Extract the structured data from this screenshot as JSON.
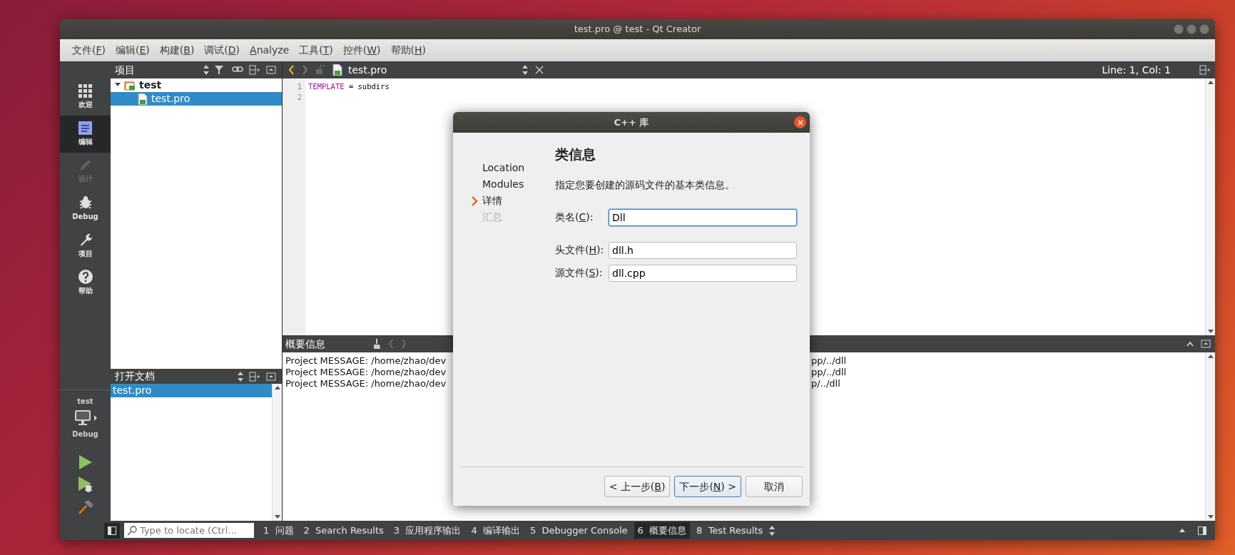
{
  "window": {
    "title": "test.pro @ test - Qt Creator"
  },
  "menu": [
    {
      "before": "文件(",
      "key": "F",
      "after": ")"
    },
    {
      "before": "编辑(",
      "key": "E",
      "after": ")"
    },
    {
      "before": "构建(",
      "key": "B",
      "after": ")"
    },
    {
      "before": "调试(",
      "key": "D",
      "after": ")"
    },
    {
      "key": "A",
      "after": "nalyze"
    },
    {
      "before": "工具(",
      "key": "T",
      "after": ")"
    },
    {
      "before": "控件(",
      "key": "W",
      "after": ")"
    },
    {
      "before": "帮助(",
      "key": "H",
      "after": ")"
    }
  ],
  "modes": [
    {
      "label": "欢迎",
      "kind": "welcome",
      "selected": false,
      "disabled": false
    },
    {
      "label": "编辑",
      "kind": "edit",
      "selected": true,
      "disabled": false
    },
    {
      "label": "设计",
      "kind": "design",
      "selected": false,
      "disabled": true
    },
    {
      "label": "Debug",
      "kind": "debug",
      "selected": false,
      "disabled": false
    },
    {
      "label": "项目",
      "kind": "projects",
      "selected": false,
      "disabled": false
    },
    {
      "label": "帮助",
      "kind": "help",
      "selected": false,
      "disabled": false
    }
  ],
  "kit": {
    "project": "test",
    "config": "Debug"
  },
  "project_pane": {
    "title": "项目",
    "tree": [
      {
        "label": "test",
        "expanded": true,
        "selected": false,
        "children": [
          {
            "label": "test.pro",
            "selected": true
          }
        ]
      }
    ]
  },
  "open_documents": {
    "title": "打开文档",
    "items": [
      {
        "label": "test.pro",
        "selected": true
      }
    ]
  },
  "editor": {
    "tab": "test.pro",
    "cursor": "Line: 1, Col: 1",
    "lines": [
      {
        "number": "1",
        "code": [
          {
            "text": "TEMPLATE",
            "kind": "keyword"
          },
          {
            "text": " = subdirs",
            "kind": "plain"
          }
        ]
      },
      {
        "number": "2"
      }
    ]
  },
  "output_panel": {
    "title": "概要信息",
    "lines": [
      {
        "left": "Project MESSAGE: /home/zhao/dev",
        "right": "pp/../dll"
      },
      {
        "left": "Project MESSAGE: /home/zhao/dev",
        "right": "pp/../dll"
      },
      {
        "left": "Project MESSAGE: /home/zhao/dev",
        "right": "p/../dll"
      }
    ]
  },
  "dialog": {
    "title": "C++ 库",
    "steps": [
      {
        "label": "Location",
        "selected": false,
        "disabled": false
      },
      {
        "label": "Modules",
        "selected": false,
        "disabled": false
      },
      {
        "label": "详情",
        "selected": true,
        "disabled": false
      },
      {
        "label": "汇总",
        "selected": false,
        "disabled": true
      }
    ],
    "heading": "类信息",
    "description": "指定您要创建的源码文件的基本类信息。",
    "fields": [
      {
        "label": {
          "before": "类名(",
          "key": "C",
          "after": "):"
        },
        "value": "Dll",
        "focused": true
      },
      {
        "label": {
          "before": "头文件(",
          "key": "H",
          "after": "):"
        },
        "value": "dll.h",
        "focused": false
      },
      {
        "label": {
          "before": "源文件(",
          "key": "S",
          "after": "):"
        },
        "value": "dll.cpp",
        "focused": false
      }
    ],
    "buttons": [
      {
        "label": {
          "before": "< 上一步(",
          "key": "B",
          "after": ")"
        },
        "default": false
      },
      {
        "label": {
          "before": "下一步(",
          "key": "N",
          "after": ") >"
        },
        "default": true
      },
      {
        "label": {
          "before": "取消"
        },
        "default": false
      }
    ]
  },
  "locator": {
    "placeholder": "Type to locate (Ctrl…"
  },
  "output_tabs": [
    {
      "number": "1",
      "label": "问题",
      "selected": false
    },
    {
      "number": "2",
      "label": "Search Results",
      "selected": false
    },
    {
      "number": "3",
      "label": "应用程序输出",
      "selected": false
    },
    {
      "number": "4",
      "label": "编译输出",
      "selected": false
    },
    {
      "number": "5",
      "label": "Debugger Console",
      "selected": false
    },
    {
      "number": "6",
      "label": "概要信息",
      "selected": true
    },
    {
      "number": "8",
      "label": "Test Results",
      "selected": false
    }
  ]
}
